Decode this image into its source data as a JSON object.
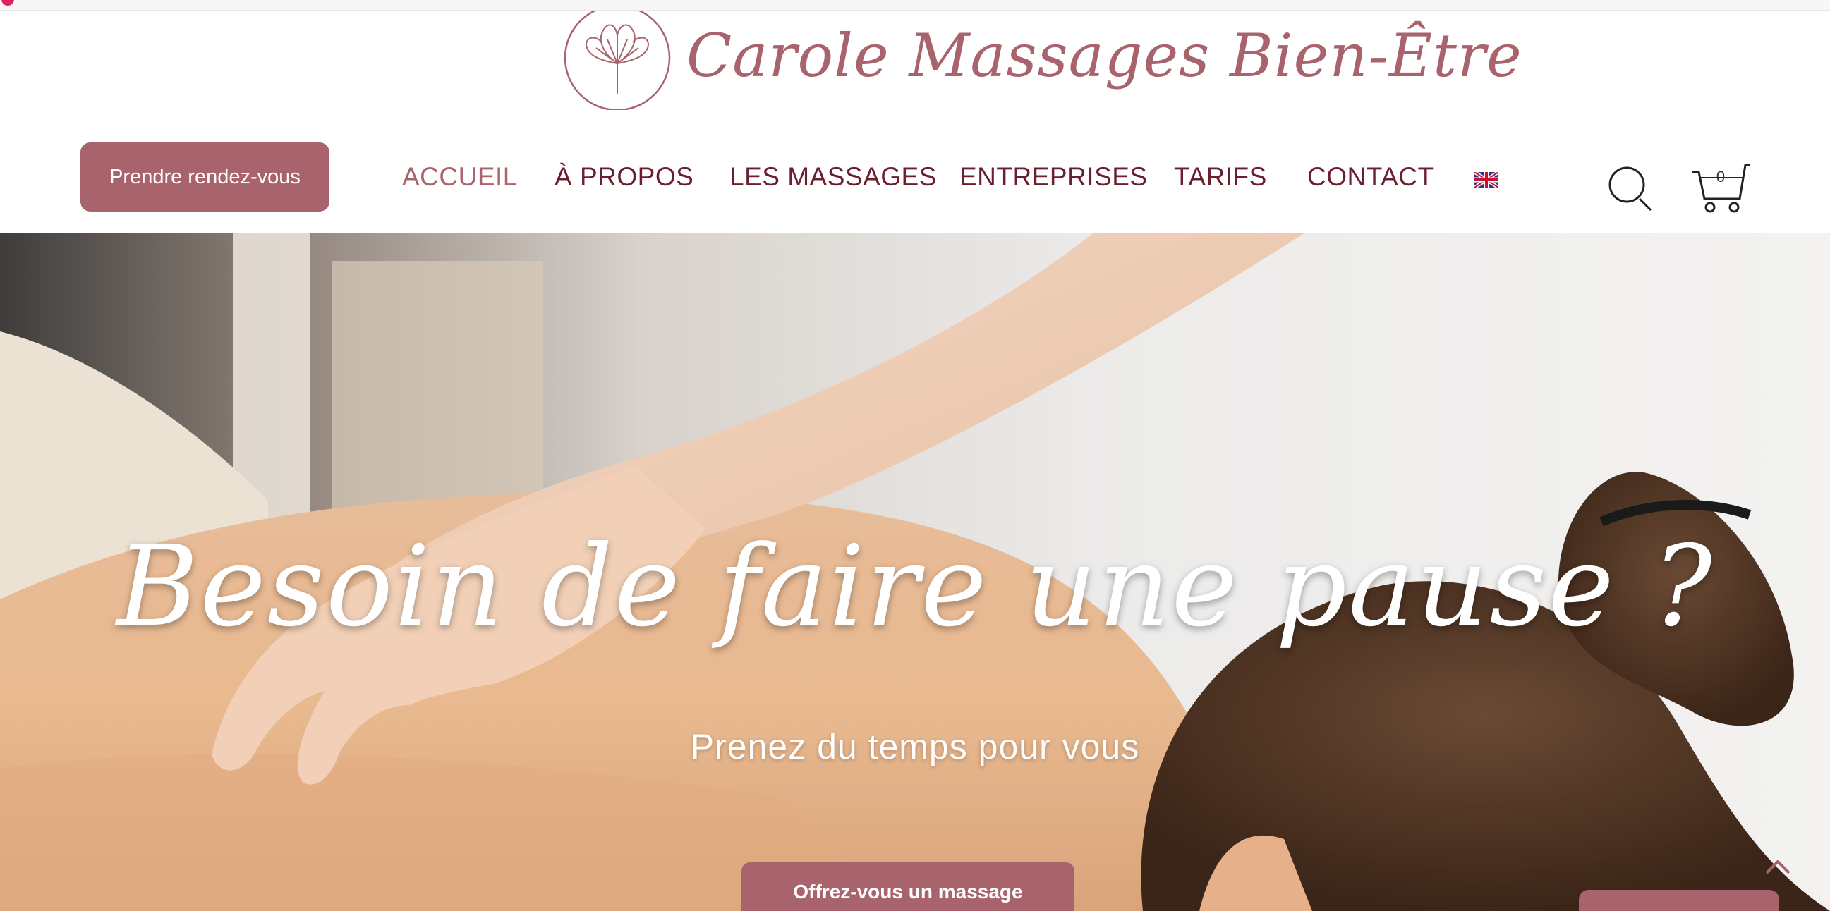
{
  "site": {
    "brand_name": "Carole Massages Bien-Être"
  },
  "header": {
    "appointment_button": "Prendre rendez-vous",
    "nav": [
      {
        "label": "ACCUEIL",
        "active": true
      },
      {
        "label": "À PROPOS",
        "active": false
      },
      {
        "label": "LES MASSAGES",
        "active": false
      },
      {
        "label": "ENTREPRISES",
        "active": false
      },
      {
        "label": "TARIFS",
        "active": false
      },
      {
        "label": "CONTACT",
        "active": false
      }
    ],
    "language_flag": "uk-flag-icon",
    "cart_count": "0"
  },
  "hero": {
    "title": "Besoin de faire une pause ?",
    "subtitle": "Prenez du temps pour vous",
    "cta": "Offrez-vous un massage"
  },
  "colors": {
    "brand": "#a8636c",
    "nav_text": "#6b1f2e",
    "white": "#ffffff"
  }
}
